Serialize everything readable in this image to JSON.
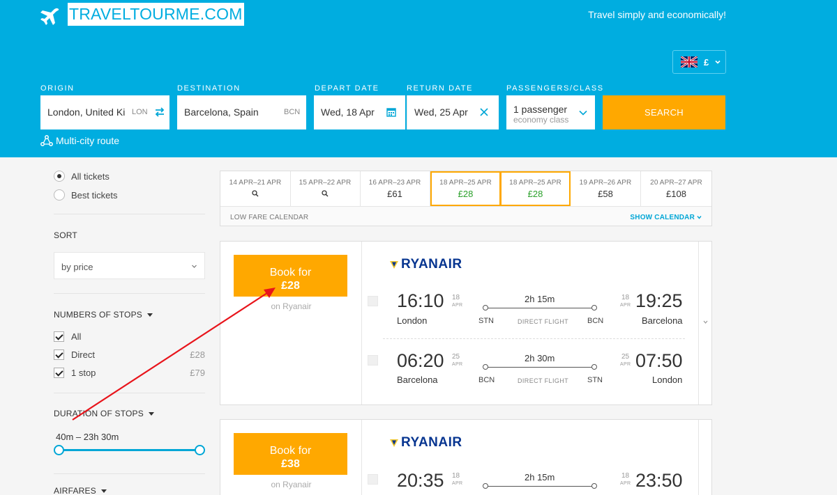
{
  "header": {
    "logo": "TRAVELTOURME.COM",
    "tagline": "Travel simply and economically!",
    "currency": "£",
    "brand_color": "#00ade0",
    "accent_color": "#ffa800"
  },
  "search": {
    "origin_label": "ORIGIN",
    "origin_value": "London, United Ki",
    "origin_code": "LON",
    "destination_label": "DESTINATION",
    "destination_value": "Barcelona, Spain",
    "destination_code": "BCN",
    "depart_label": "DEPART DATE",
    "depart_value": "Wed, 18 Apr",
    "return_label": "RETURN DATE",
    "return_value": "Wed, 25 Apr",
    "passengers_label": "PASSENGERS/CLASS",
    "passengers_value": "1 passenger",
    "class_value": "economy class",
    "search_button": "SEARCH",
    "multicity": "Multi-city route"
  },
  "sidebar": {
    "ticket_filter": [
      {
        "label": "All tickets",
        "selected": true
      },
      {
        "label": "Best tickets",
        "selected": false
      }
    ],
    "sort_heading": "SORT",
    "sort_value": "by price",
    "stops_heading": "NUMBERS OF STOPS",
    "stops": [
      {
        "label": "All",
        "price": "",
        "checked": true
      },
      {
        "label": "Direct",
        "price": "£28",
        "checked": true
      },
      {
        "label": "1 stop",
        "price": "£79",
        "checked": true
      }
    ],
    "duration_heading": "DURATION OF STOPS",
    "duration_range": "40m – 23h 30m",
    "airfares_heading": "AIRFARES"
  },
  "calendar": {
    "cells": [
      {
        "dates": "14 APR–21 APR",
        "price": "",
        "selected": false,
        "icon": "search-icon"
      },
      {
        "dates": "15 APR–22 APR",
        "price": "",
        "selected": false,
        "icon": "search-icon"
      },
      {
        "dates": "16 APR–23 APR",
        "price": "£61",
        "selected": false
      },
      {
        "dates": "18 APR–25 APR",
        "price": "£28",
        "selected": true
      },
      {
        "dates": "18 APR–25 APR",
        "price": "£28",
        "selected": true
      },
      {
        "dates": "19 APR–26 APR",
        "price": "£58",
        "selected": false
      },
      {
        "dates": "20 APR–27 APR",
        "price": "£108",
        "selected": false
      }
    ],
    "footer_left": "LOW FARE CALENDAR",
    "footer_right": "SHOW CALENDAR"
  },
  "results": [
    {
      "book_label": "Book for",
      "price": "£28",
      "carrier_text": "on Ryanair",
      "airline": "RYANAIR",
      "segments": [
        {
          "dep_time": "16:10",
          "dep_day": "18",
          "dep_mon": "APR",
          "dep_city": "London",
          "dep_code": "STN",
          "duration": "2h 15m",
          "type": "DIRECT FLIGHT",
          "arr_time": "19:25",
          "arr_day": "18",
          "arr_mon": "APR",
          "arr_city": "Barcelona",
          "arr_code": "BCN"
        },
        {
          "dep_time": "06:20",
          "dep_day": "25",
          "dep_mon": "APR",
          "dep_city": "Barcelona",
          "dep_code": "BCN",
          "duration": "2h 30m",
          "type": "DIRECT FLIGHT",
          "arr_time": "07:50",
          "arr_day": "25",
          "arr_mon": "APR",
          "arr_city": "London",
          "arr_code": "STN"
        }
      ]
    },
    {
      "book_label": "Book for",
      "price": "£38",
      "carrier_text": "on Ryanair",
      "airline": "RYANAIR",
      "segments": [
        {
          "dep_time": "20:35",
          "dep_day": "18",
          "dep_mon": "APR",
          "duration": "2h 15m",
          "arr_time": "23:50",
          "arr_day": "18",
          "arr_mon": "APR"
        }
      ]
    }
  ]
}
